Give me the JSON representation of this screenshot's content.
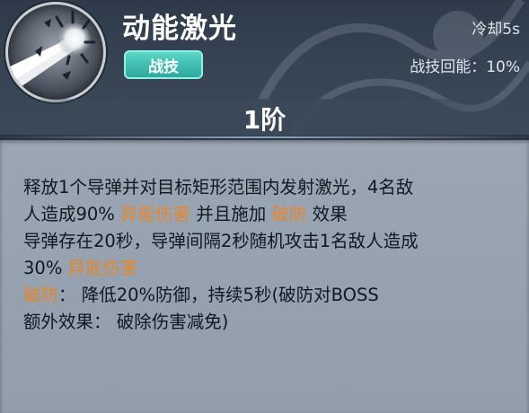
{
  "skill": {
    "name": "动能激光",
    "tag": "战技",
    "cooldown": "冷却5s",
    "energy_label": "战技回能：",
    "energy_value": "10%",
    "level": "1阶",
    "icon": "laser-beam-icon"
  },
  "description": {
    "line1": "释放1个导弹并对目标矩形范围内发射激光，4名敌",
    "line2_a": "人造成90% ",
    "line2_b": "异能伤害",
    "line2_c": " 并且施加 ",
    "line2_d": "破防",
    "line2_e": " 效果",
    "line3": "导弹存在20秒，导弹间隔2秒随机攻击1名敌人造成",
    "line4_a": "30% ",
    "line4_b": "异能伤害",
    "line5_a": "破防",
    "line5_b": "： 降低20%防御，持续5秒(破防对BOSS",
    "line6": "额外效果：  破除伤害减免)"
  },
  "colors": {
    "highlight": "#e8852a",
    "tag": "#3bbcb0",
    "panel": "#96a2b0",
    "header": "#333f4e"
  }
}
